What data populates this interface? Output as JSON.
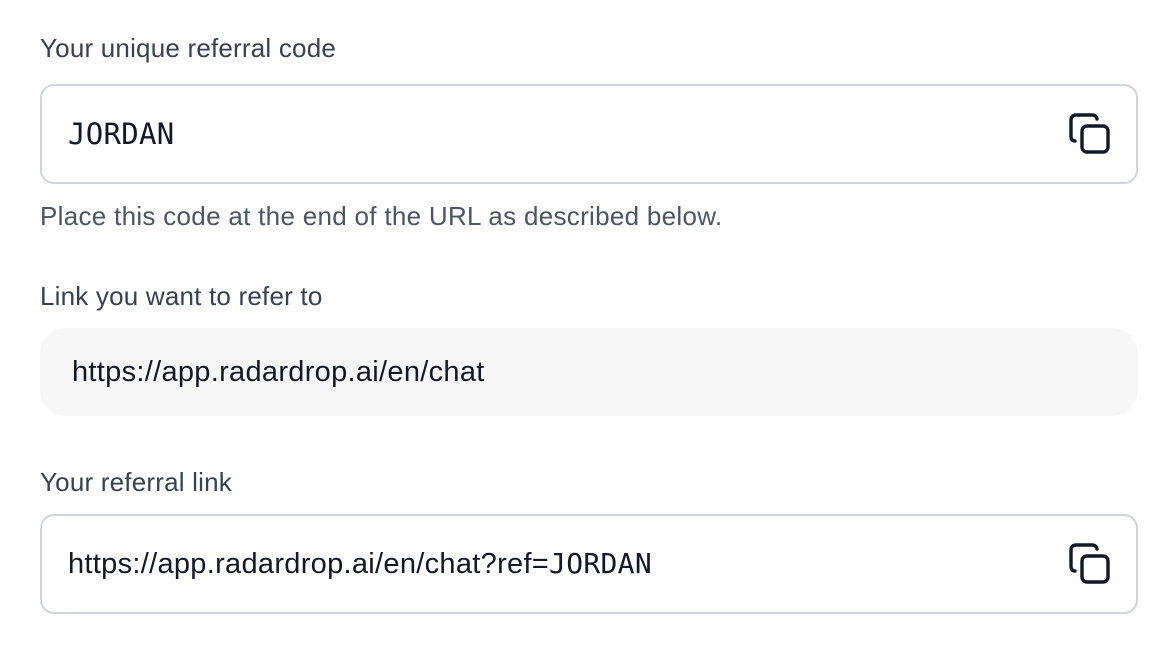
{
  "referral_code": {
    "label": "Your unique referral code",
    "value": "JORDAN",
    "copy_icon": "copy-icon",
    "helper": "Place this code at the end of the URL as described below."
  },
  "target_link": {
    "label": "Link you want to refer to",
    "value": "https://app.radardrop.ai/en/chat"
  },
  "referral_link": {
    "label": "Your referral link",
    "value_prefix": "https://app.radardrop.ai/en/chat?ref=",
    "value_code": "JORDAN",
    "copy_icon": "copy-icon"
  },
  "colors": {
    "border": "#d1d5db",
    "readonly_bg": "#f7f7f7",
    "label": "#374151",
    "helper": "#4b5563"
  }
}
